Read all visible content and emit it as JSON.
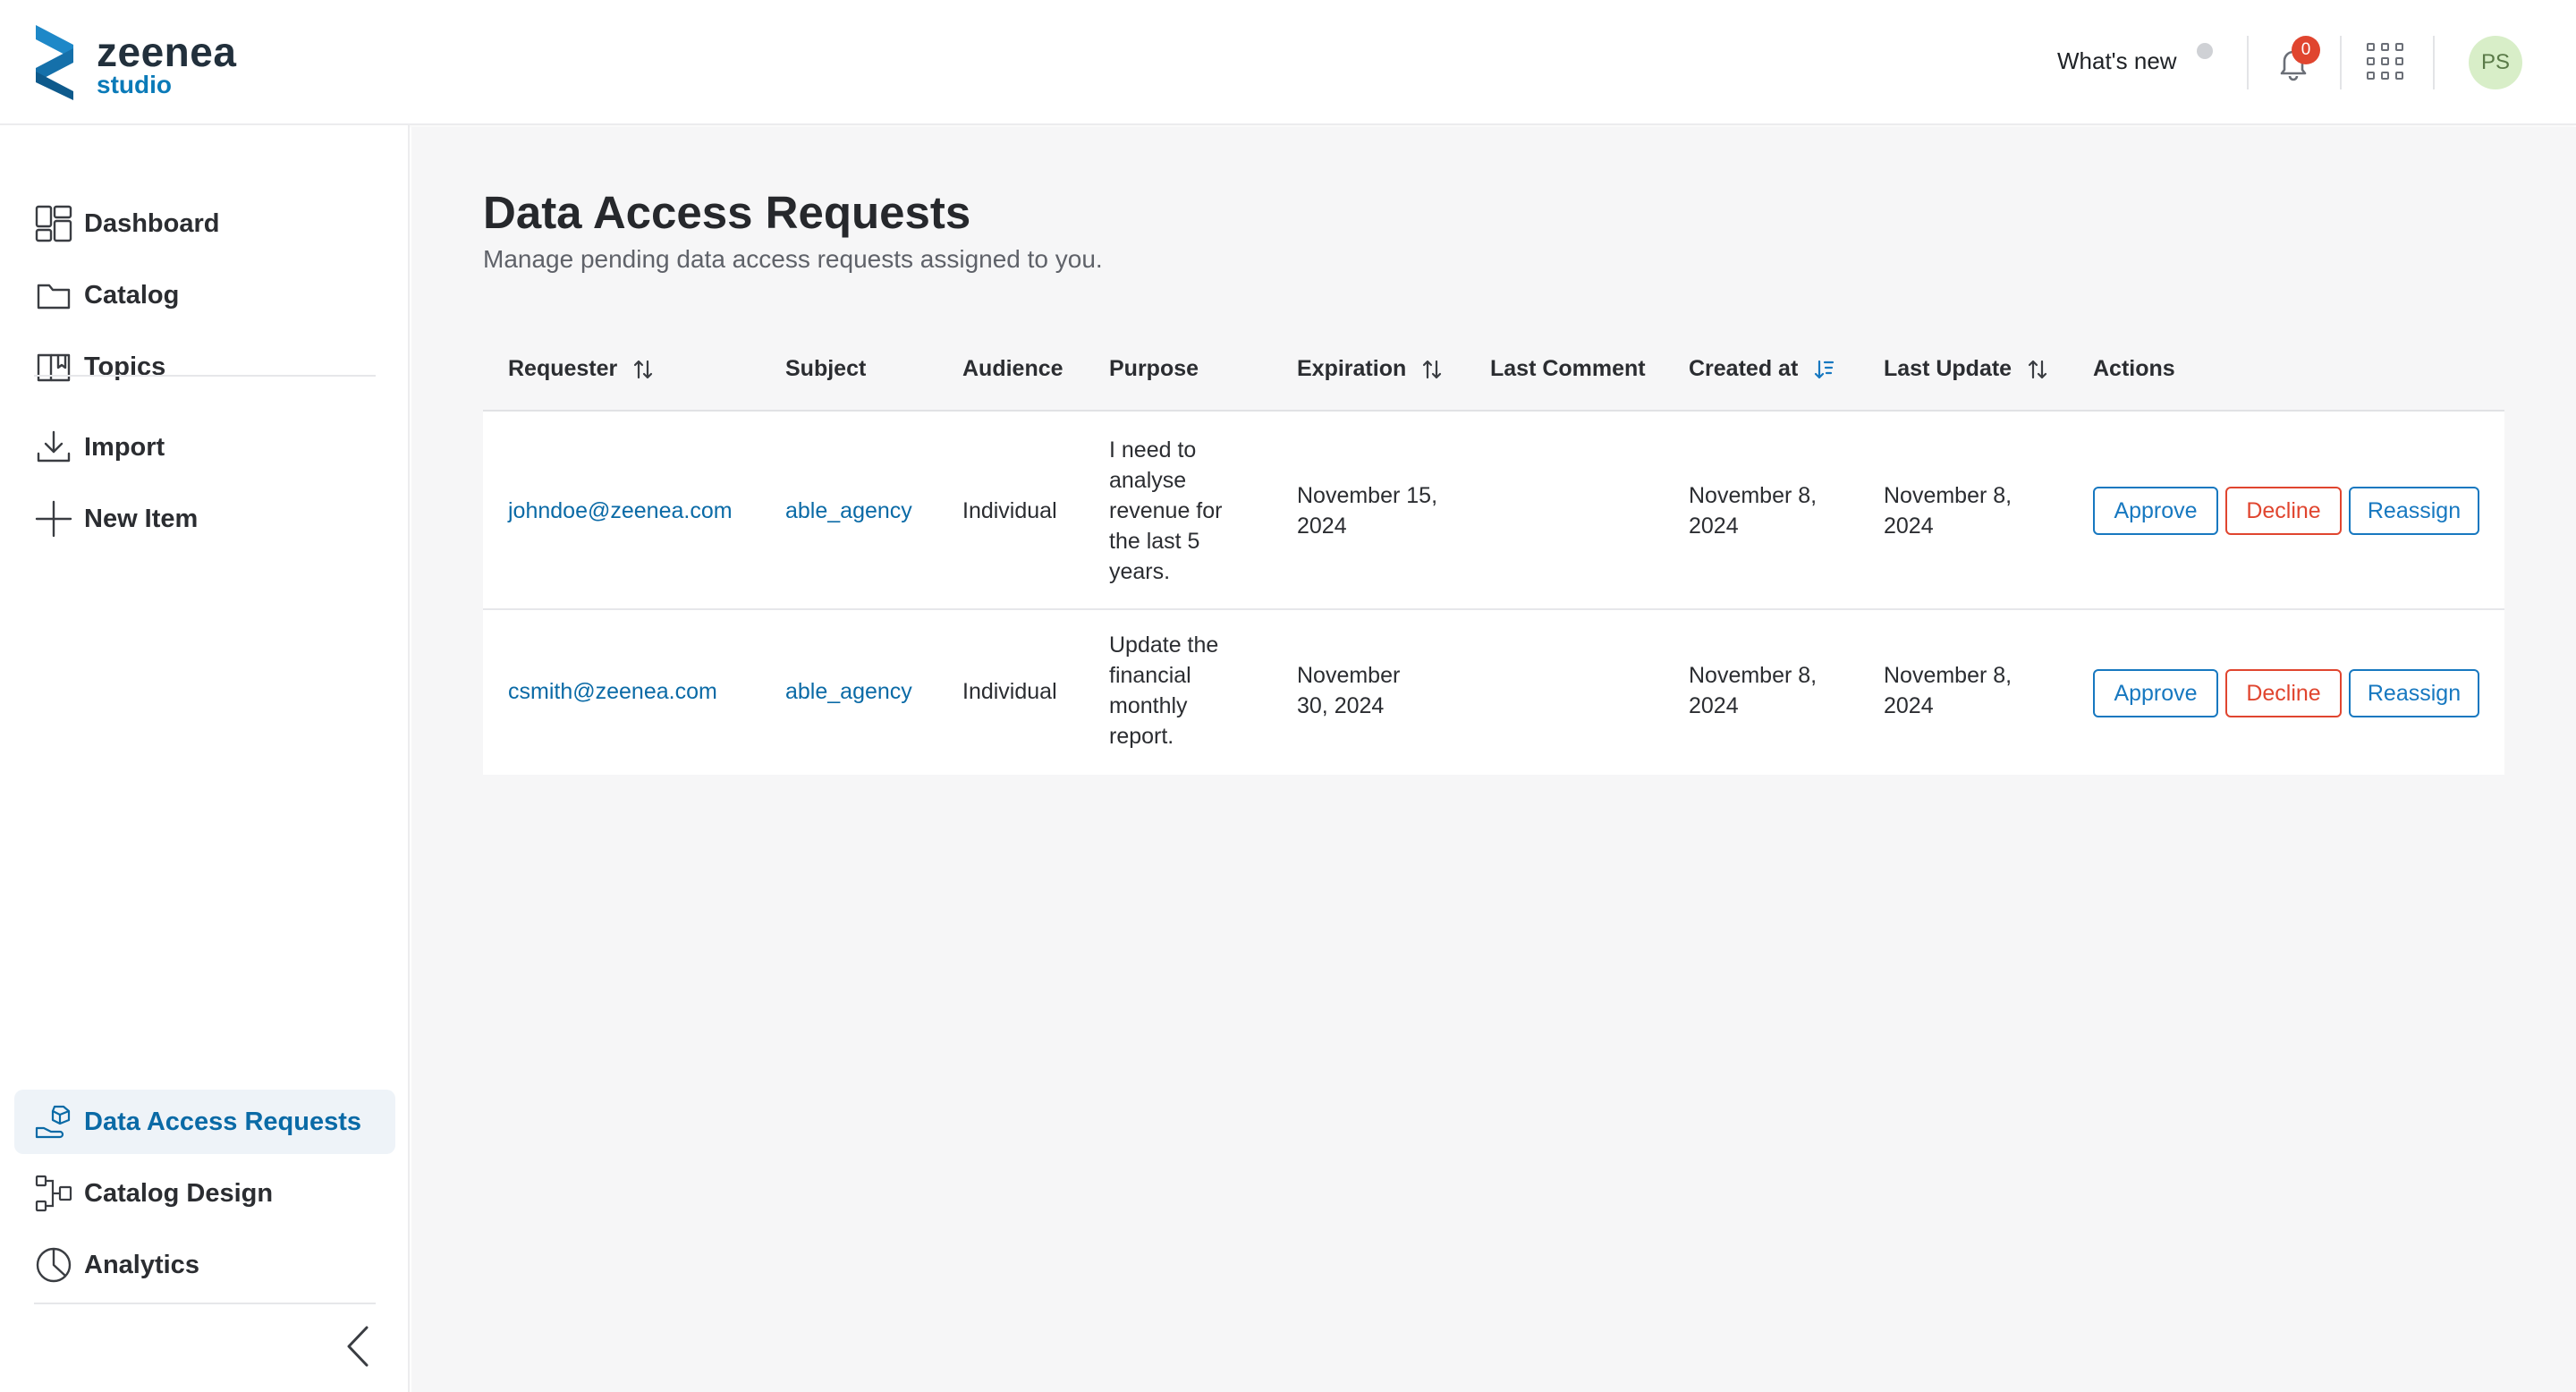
{
  "brand": {
    "word": "zeenea",
    "sub": "studio"
  },
  "header": {
    "whats_new": "What's new",
    "notifications_count": "0",
    "avatar_initials": "PS"
  },
  "sidebar": {
    "items": [
      {
        "label": "Dashboard",
        "icon": "dashboard-icon"
      },
      {
        "label": "Catalog",
        "icon": "folder-icon"
      },
      {
        "label": "Topics",
        "icon": "book-icon"
      },
      {
        "label": "Import",
        "icon": "download-icon"
      },
      {
        "label": "New Item",
        "icon": "plus-icon"
      },
      {
        "label": "Data Access Requests",
        "icon": "hand-box-icon",
        "active": true
      },
      {
        "label": "Catalog Design",
        "icon": "design-icon"
      },
      {
        "label": "Analytics",
        "icon": "pie-icon"
      }
    ]
  },
  "page": {
    "title": "Data Access Requests",
    "subtitle": "Manage pending data access requests assigned to you."
  },
  "table": {
    "columns": [
      "Requester",
      "Subject",
      "Audience",
      "Purpose",
      "Expiration",
      "Last Comment",
      "Created at",
      "Last Update",
      "Actions"
    ],
    "rows": [
      {
        "requester": "johndoe@zeenea.com",
        "subject": "able_agency",
        "audience": "Individual",
        "purpose": [
          "I need to",
          "analyse",
          "revenue for",
          "the last 5",
          "years."
        ],
        "expiration": [
          "November 15,",
          "2024"
        ],
        "last_comment": "",
        "created_at": [
          "November 8,",
          "2024"
        ],
        "last_update": [
          "November 8,",
          "2024"
        ]
      },
      {
        "requester": "csmith@zeenea.com",
        "subject": "able_agency",
        "audience": "Individual",
        "purpose": [
          "Update the",
          "financial",
          "monthly",
          "report."
        ],
        "expiration": [
          "November",
          "30, 2024"
        ],
        "last_comment": "",
        "created_at": [
          "November 8,",
          "2024"
        ],
        "last_update": [
          "November 8,",
          "2024"
        ]
      }
    ],
    "actions": {
      "approve": "Approve",
      "decline": "Decline",
      "reassign": "Reassign"
    }
  },
  "colors": {
    "accent": "#0a6aa6",
    "danger": "#e0452f",
    "badge": "#e0452f"
  }
}
